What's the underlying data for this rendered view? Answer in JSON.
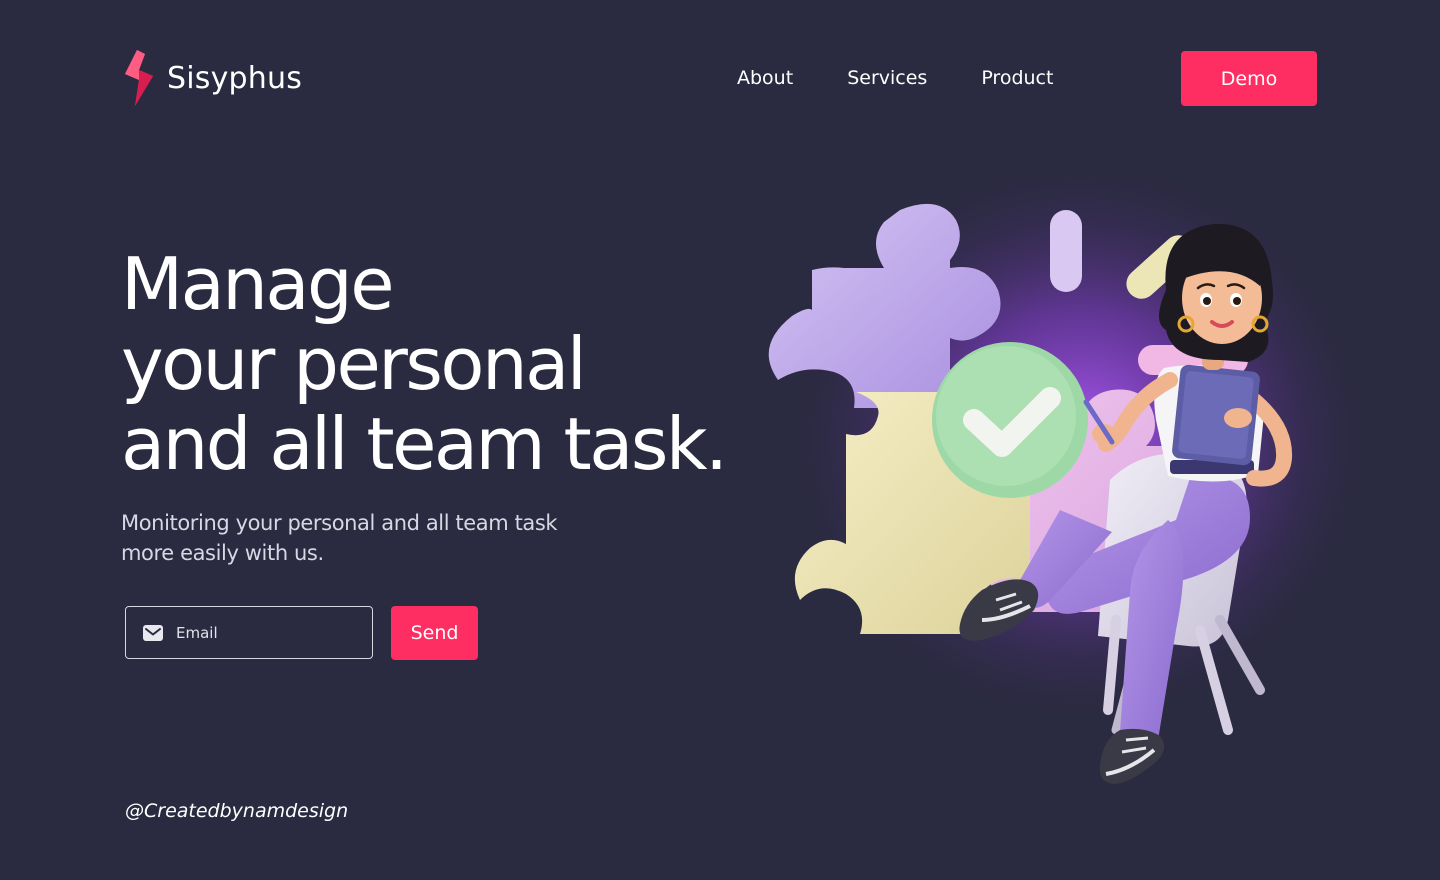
{
  "brand": {
    "name": "Sisyphus",
    "accent": "#ff2e62",
    "background": "#2a2a40"
  },
  "nav": {
    "items": [
      {
        "label": "About"
      },
      {
        "label": "Services"
      },
      {
        "label": "Product"
      }
    ],
    "demo_label": "Demo"
  },
  "hero": {
    "headline_lines": [
      "Manage",
      "your personal",
      "and all team task."
    ],
    "subtext_lines": [
      "Monitoring your personal and all team task",
      "more easily with us."
    ]
  },
  "form": {
    "email_placeholder": "Email",
    "email_icon": "mail-icon",
    "send_label": "Send"
  },
  "footer": {
    "credit": "@Createdbynamdesign"
  },
  "illustration": {
    "description_icon": "woman-with-tablet-puzzle-illustration"
  }
}
